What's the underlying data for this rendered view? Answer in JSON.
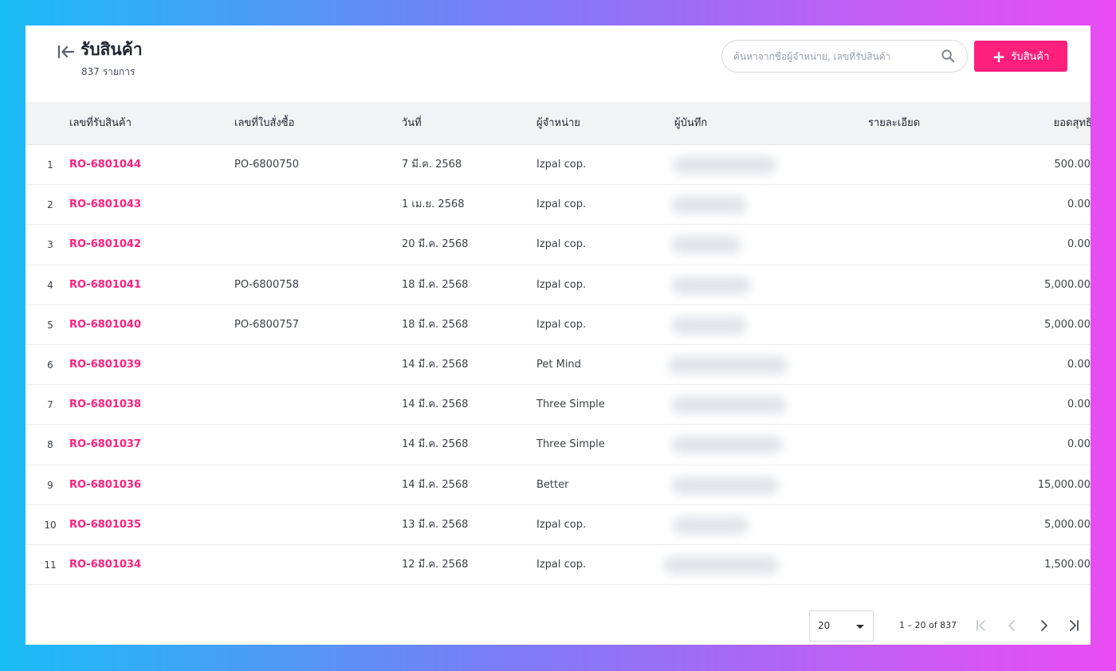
{
  "header": {
    "title": "รับสินค้า",
    "count_text": "837 รายการ",
    "back_icon": "collapse-left-icon"
  },
  "search": {
    "placeholder": "ค้นหาจากชื่อผู้จำหน่าย, เลขที่รับสินค้า",
    "value": ""
  },
  "add_button": {
    "label": "รับสินค้า",
    "icon": "plus-icon"
  },
  "colors": {
    "accent": "#ff1f7d",
    "header_bg": "#f2f3f5",
    "row_border": "#e9ebee"
  },
  "table": {
    "columns": [
      "เลขที่รับสินค้า",
      "เลขที่ใบสั่งซื้อ",
      "วันที่",
      "ผู้จำหน่าย",
      "ผู้บันทึก",
      "รายละเอียด",
      "ยอดสุทธิ"
    ],
    "rows": [
      {
        "index": "1",
        "ro": "RO-6801044",
        "po": "PO-6800750",
        "date": "7 มี.ค. 2568",
        "vendor": "Izpal cop.",
        "detail": "",
        "total": "500.00"
      },
      {
        "index": "2",
        "ro": "RO-6801043",
        "po": "",
        "date": "1 เม.ย. 2568",
        "vendor": "Izpal cop.",
        "detail": "",
        "total": "0.00"
      },
      {
        "index": "3",
        "ro": "RO-6801042",
        "po": "",
        "date": "20 มี.ค. 2568",
        "vendor": "Izpal cop.",
        "detail": "",
        "total": "0.00"
      },
      {
        "index": "4",
        "ro": "RO-6801041",
        "po": "PO-6800758",
        "date": "18 มี.ค. 2568",
        "vendor": "Izpal cop.",
        "detail": "",
        "total": "5,000.00"
      },
      {
        "index": "5",
        "ro": "RO-6801040",
        "po": "PO-6800757",
        "date": "18 มี.ค. 2568",
        "vendor": "Izpal cop.",
        "detail": "",
        "total": "5,000.00"
      },
      {
        "index": "6",
        "ro": "RO-6801039",
        "po": "",
        "date": "14 มี.ค. 2568",
        "vendor": "Pet Mind",
        "detail": "",
        "total": "0.00"
      },
      {
        "index": "7",
        "ro": "RO-6801038",
        "po": "",
        "date": "14 มี.ค. 2568",
        "vendor": "Three Simple",
        "detail": "",
        "total": "0.00"
      },
      {
        "index": "8",
        "ro": "RO-6801037",
        "po": "",
        "date": "14 มี.ค. 2568",
        "vendor": "Three Simple",
        "detail": "",
        "total": "0.00"
      },
      {
        "index": "9",
        "ro": "RO-6801036",
        "po": "",
        "date": "14 มี.ค. 2568",
        "vendor": "Better",
        "detail": "",
        "total": "15,000.00"
      },
      {
        "index": "10",
        "ro": "RO-6801035",
        "po": "",
        "date": "13 มี.ค. 2568",
        "vendor": "Izpal cop.",
        "detail": "",
        "total": "5,000.00"
      },
      {
        "index": "11",
        "ro": "RO-6801034",
        "po": "",
        "date": "12 มี.ค. 2568",
        "vendor": "Izpal cop.",
        "detail": "",
        "total": "1,500.00"
      }
    ]
  },
  "pagination": {
    "page_size": "20",
    "range_text": "1 – 20 of 837",
    "icons": [
      "first-page-icon",
      "previous-page-icon",
      "next-page-icon",
      "last-page-icon"
    ]
  }
}
